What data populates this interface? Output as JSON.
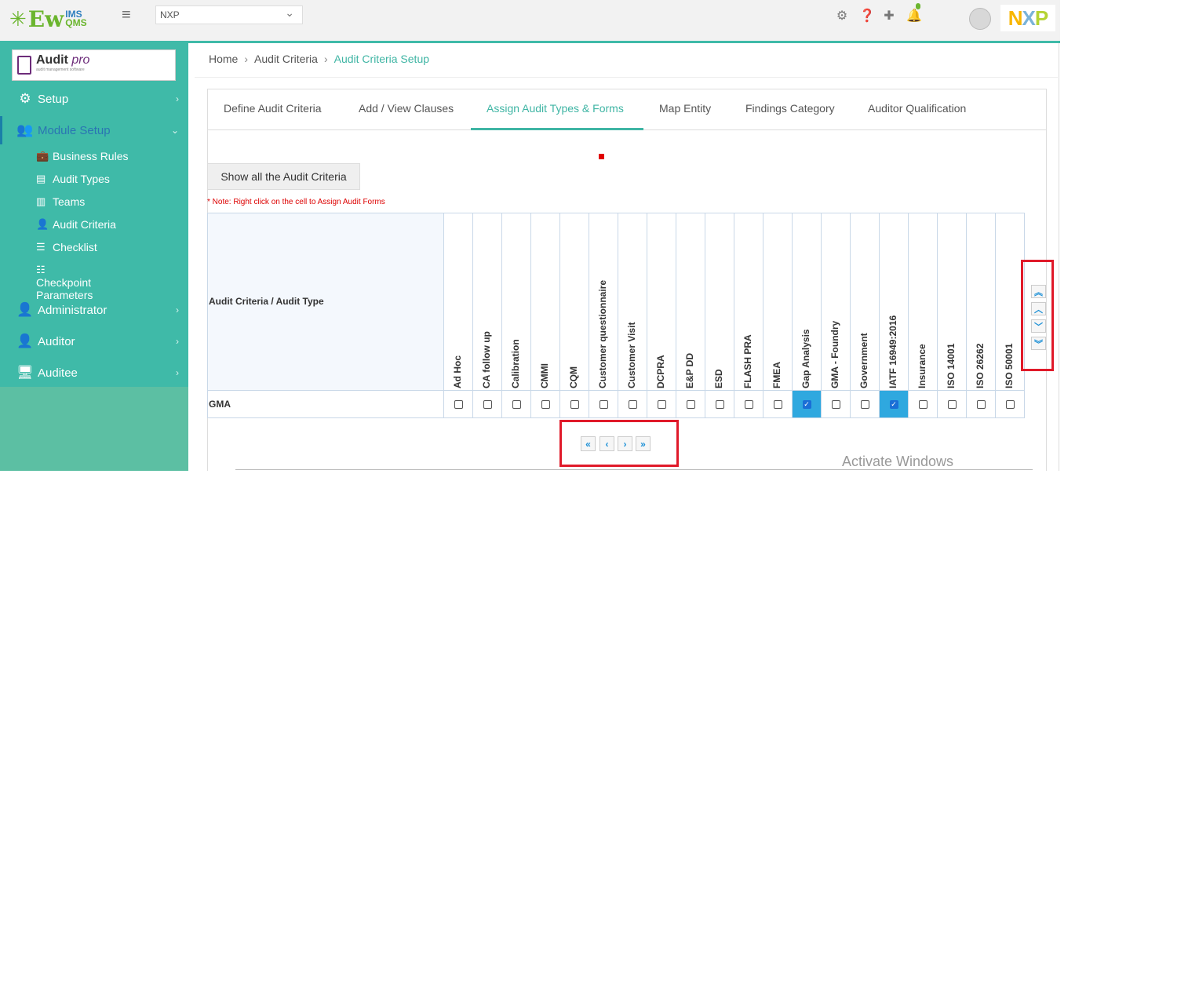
{
  "header": {
    "logo_ew": "Ew",
    "logo_ims": "IMS",
    "logo_qms": "QMS",
    "org_select": "NXP",
    "brand_logo": "NXP"
  },
  "sidebar": {
    "brand_title": "Audit",
    "brand_title_suffix": "pro",
    "brand_subtitle": "audit management software",
    "items": [
      {
        "label": "Setup",
        "icon": "gear-icon"
      },
      {
        "label": "Module Setup",
        "icon": "users-cog-icon"
      },
      {
        "label": "Administrator",
        "icon": "user-cog-icon"
      },
      {
        "label": "Auditor",
        "icon": "user-check-icon"
      },
      {
        "label": "Auditee",
        "icon": "user-desk-icon"
      }
    ],
    "sub_items": [
      {
        "label": "Business Rules",
        "icon": "briefcase-icon"
      },
      {
        "label": "Audit Types",
        "icon": "list-icon"
      },
      {
        "label": "Teams",
        "icon": "building-icon"
      },
      {
        "label": "Audit Criteria",
        "icon": "user-tie-icon"
      },
      {
        "label": "Checklist",
        "icon": "checklist-icon"
      },
      {
        "label": "Checkpoint Parameters",
        "icon": "tasks-icon"
      }
    ]
  },
  "breadcrumb": {
    "items": [
      "Home",
      "Audit Criteria",
      "Audit Criteria Setup"
    ]
  },
  "tabs": [
    "Define Audit Criteria",
    "Add / View Clauses",
    "Assign Audit Types & Forms",
    "Map Entity",
    "Findings Category",
    "Auditor Qualification"
  ],
  "active_tab": "Assign Audit Types & Forms",
  "show_all_button": "Show all the Audit Criteria",
  "note": "* Note: Right click on the cell to Assign Audit Forms",
  "grid": {
    "corner_header": "Audit Criteria / Audit Type",
    "columns": [
      "Ad Hoc",
      "CA follow up",
      "Calibration",
      "CMMI",
      "CQM",
      "Customer questionnaire",
      "Customer Visit",
      "DCPRA",
      "E&P DD",
      "ESD",
      "FLASH PRA",
      "FMEA",
      "Gap Analysis",
      "GMA - Foundry",
      "Government",
      "IATF 16949:2016",
      "Insurance",
      "ISO 14001",
      "ISO 26262",
      "ISO 50001"
    ],
    "rows": [
      {
        "label": "GMA",
        "checked": [
          false,
          false,
          false,
          false,
          false,
          false,
          false,
          false,
          false,
          false,
          false,
          false,
          true,
          false,
          false,
          true,
          false,
          false,
          false,
          false
        ]
      }
    ],
    "accent_color": "#2fa8df"
  },
  "watermark": "Activate Windows",
  "colors": {
    "sidebar": "#3fbaa8",
    "accent": "#3fb5a4",
    "highlight_box": "#e01a2a"
  }
}
